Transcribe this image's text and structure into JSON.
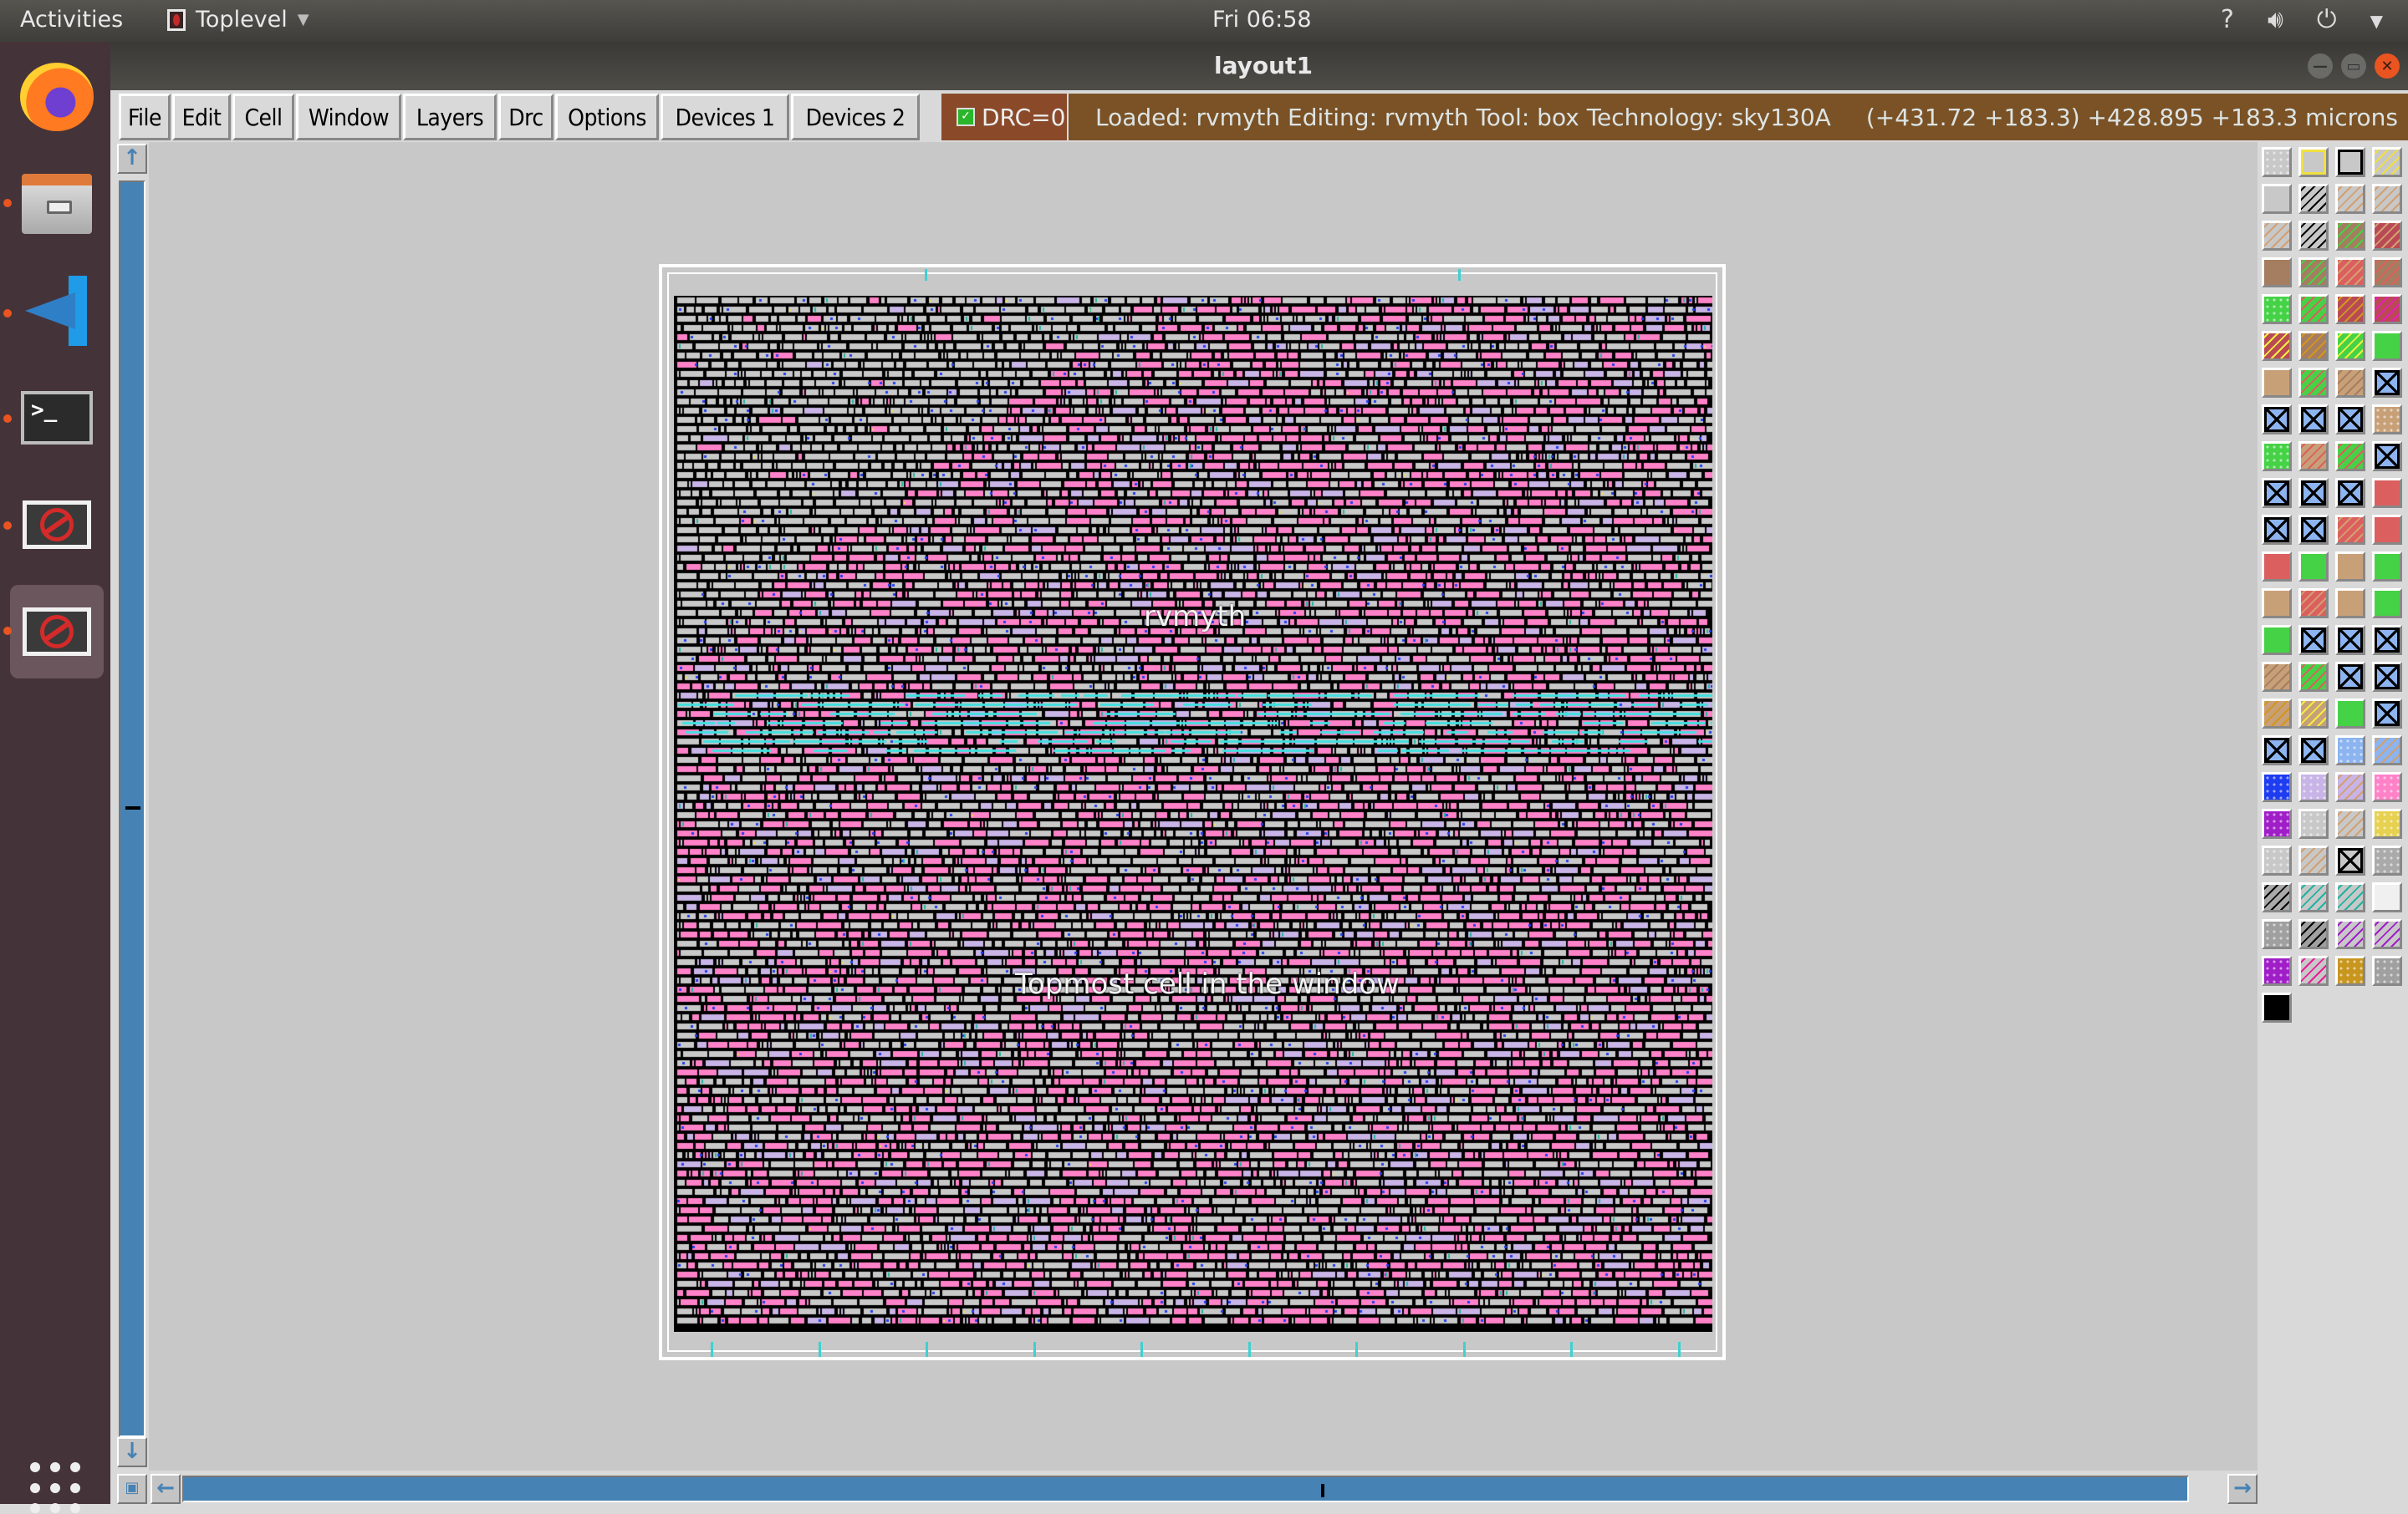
{
  "topbar": {
    "activities": "Activities",
    "app_name": "Toplevel",
    "clock": "Fri 06:58",
    "tray_icons": [
      "network-unknown-icon",
      "volume-icon",
      "power-icon",
      "system-menu-arrow-icon"
    ]
  },
  "dock": {
    "items": [
      {
        "name": "firefox",
        "running": false
      },
      {
        "name": "files",
        "running": true
      },
      {
        "name": "vscode",
        "running": true
      },
      {
        "name": "terminal",
        "running": true
      },
      {
        "name": "unknown-app",
        "running": true
      },
      {
        "name": "unknown-app",
        "running": true,
        "active": true
      }
    ],
    "show_apps": "show-applications-icon"
  },
  "window": {
    "title": "layout1"
  },
  "menu": {
    "items": [
      "File",
      "Edit",
      "Cell",
      "Window",
      "Layers",
      "Drc",
      "Options",
      "Devices 1",
      "Devices 2"
    ],
    "drc_label": "DRC=0",
    "drc_checked": true
  },
  "status": {
    "message": "Loaded: rvmyth Editing: rvmyth Tool: box  Technology: sky130A",
    "coordinates": "(+431.72 +183.3) +428.895 +183.3 microns"
  },
  "layout": {
    "cell_name": "rvmyth",
    "window_label": "Topmost cell in the window"
  },
  "colors": {
    "status_bg": "#7a5226",
    "drc_bg": "#8a4a2a",
    "scroll_accent": "#4682b4",
    "canvas_bg": "#c8c8c8",
    "dock_bg": "#45333a",
    "close_btn": "#e95420"
  },
  "palette": {
    "columns": 4,
    "swatches": [
      "dots-white",
      "outline-yellow",
      "outline-black",
      "hatch-yellow",
      "solid-gray",
      "hatch-black",
      "hatch-tan",
      "hatch-tan",
      "hatch-tan",
      "hatch-black",
      "brown-green-hatch",
      "red-tan-hatch",
      "solid-brown",
      "brown-crosshatch",
      "red-hatch",
      "brown-red-hatch",
      "green-red-dots",
      "green-red-dots-hatch",
      "red-orange-hatch",
      "red-magenta-hatch",
      "red-yellow-hatch",
      "brown-orange-crosshatch",
      "green-yellow-hatch",
      "solid-green",
      "solid-tan",
      "green-red-hatch",
      "tan-hatch",
      "contact-blue",
      "contact-blue",
      "contact-blue",
      "contact-blue",
      "tan-dots",
      "green-dots",
      "tan-dots-hatch",
      "green-dots-hatch",
      "contact-blue",
      "contact-blue",
      "contact-blue",
      "contact-blue",
      "solid-red",
      "contact-red",
      "contact-red",
      "red-hatch",
      "solid-red",
      "solid-red",
      "solid-green",
      "solid-tan",
      "solid-green",
      "solid-tan",
      "red-hatch",
      "solid-tan",
      "solid-green",
      "solid-green",
      "contact-blue",
      "contact-green",
      "contact-green",
      "tan-hatch",
      "green-red-hatch",
      "contact-blue",
      "contact-green",
      "tan-orange-hatch",
      "tan-yellow-hatch",
      "solid-green",
      "contact-blue",
      "contact-yellow",
      "contact-green",
      "blue-stripes",
      "blue-stripes-hatch",
      "blue-solid-pattern",
      "lavender-check",
      "lavender-hatch",
      "pink-pattern",
      "purple-stripes",
      "pink-rings",
      "pink-rings-hatch",
      "yellow-pink-rings",
      "gray-rings",
      "gray-rings-hatch",
      "contact-teal",
      "pink-check",
      "pink-check-hatch",
      "teal-hatch",
      "teal-tan-hatch",
      "magenta-white",
      "gray-check",
      "gray-check-hatch",
      "purple-hatch",
      "purple-tan-hatch",
      "purple-pattern",
      "magenta-hatch",
      "orange-pattern",
      "gray-stripes",
      "solid-black"
    ]
  }
}
